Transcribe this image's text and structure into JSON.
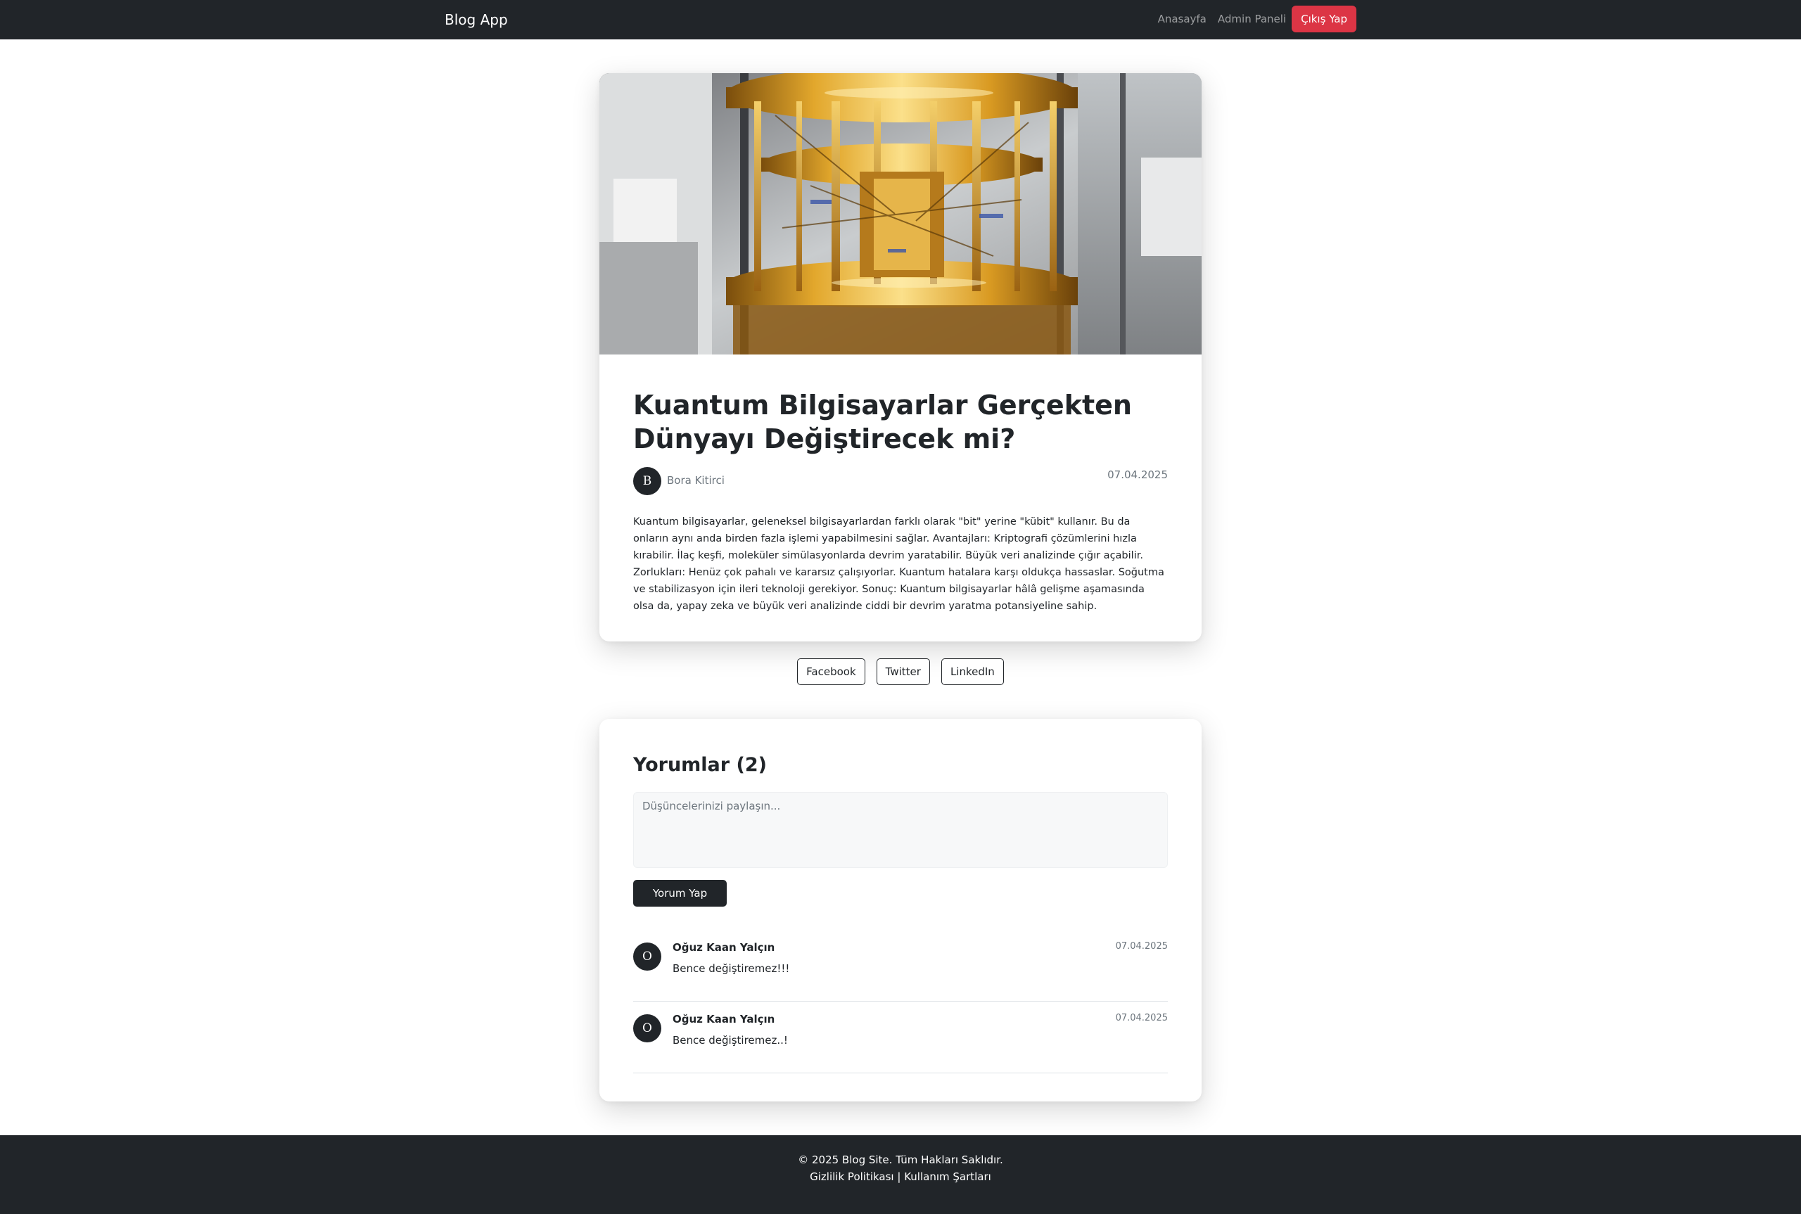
{
  "navbar": {
    "brand": "Blog App",
    "home": "Anasayfa",
    "admin": "Admin Paneli",
    "logout": "Çıkış Yap",
    "logout_color": "#dc3545"
  },
  "post": {
    "image_icon": "quantum-computer-photo",
    "title": "Kuantum Bilgisayarlar Gerçekten Dünyayı Değiştirecek mi?",
    "author_initial": "B",
    "author": "Bora Kitirci",
    "date": "07.04.2025",
    "content": "Kuantum bilgisayarlar, geleneksel bilgisayarlardan farklı olarak \"bit\" yerine \"kübit\" kullanır. Bu da onların aynı anda birden fazla işlemi yapabilmesini sağlar. Avantajları: Kriptografi çözümlerini hızla kırabilir. İlaç keşfi, moleküler simülasyonlarda devrim yaratabilir. Büyük veri analizinde çığır açabilir. Zorlukları: Henüz çok pahalı ve kararsız çalışıyorlar. Kuantum hatalara karşı oldukça hassaslar. Soğutma ve stabilizasyon için ileri teknoloji gerekiyor. Sonuç: Kuantum bilgisayarlar hâlâ gelişme aşamasında olsa da, yapay zeka ve büyük veri analizinde ciddi bir devrim yaratma potansiyeline sahip."
  },
  "share": {
    "facebook": "Facebook",
    "twitter": "Twitter",
    "linkedin": "LinkedIn"
  },
  "comments": {
    "title": "Yorumlar (2)",
    "placeholder": "Düşüncelerinizi paylaşın...",
    "submit": "Yorum Yap",
    "items": [
      {
        "initial": "O",
        "author": "Oğuz Kaan Yalçın",
        "date": "07.04.2025",
        "text": "Bence değiştiremez!!!"
      },
      {
        "initial": "O",
        "author": "Oğuz Kaan Yalçın",
        "date": "07.04.2025",
        "text": "Bence değiştiremez..!"
      }
    ]
  },
  "footer": {
    "copyright": "© 2025 Blog Site. Tüm Hakları Saklıdır.",
    "privacy": "Gizlilik Politikası",
    "separator": " | ",
    "terms": "Kullanım Şartları"
  }
}
